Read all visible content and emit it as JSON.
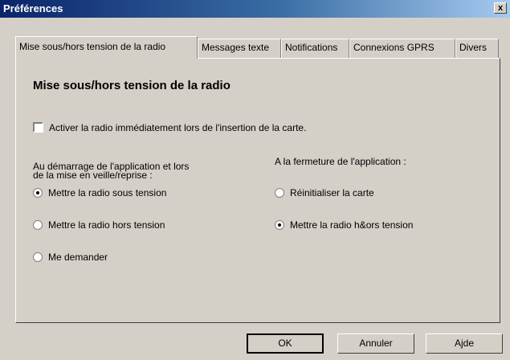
{
  "window": {
    "title": "Préférences",
    "close_glyph": "x"
  },
  "tabs": [
    {
      "label": "Mise sous/hors tension de la radio",
      "active": true
    },
    {
      "label": "Messages texte",
      "active": false
    },
    {
      "label": "Notifications",
      "active": false
    },
    {
      "label": "Connexions GPRS",
      "active": false
    },
    {
      "label": "Divers",
      "active": false
    }
  ],
  "panel": {
    "heading": "Mise sous/hors tension de la radio",
    "activate_checkbox": {
      "label": "Activer la radio immédiatement lors de l'insertion de la carte.",
      "checked": false
    },
    "startup_group": {
      "label": "Au démarrage de l'application et lors\nde la mise en veille/reprise :",
      "options": [
        {
          "label": "Mettre la radio sous tension",
          "selected": true
        },
        {
          "label": "Mettre la radio hors tension",
          "selected": false
        },
        {
          "label": "Me demander",
          "selected": false
        }
      ]
    },
    "shutdown_group": {
      "label": "A la fermeture de l'application :",
      "options": [
        {
          "label": "Réinitialiser la carte",
          "selected": false
        },
        {
          "label": "Mettre la radio h&ors tension",
          "selected": true
        }
      ]
    }
  },
  "buttons": {
    "ok": "OK",
    "cancel": "Annuler",
    "help": "Ajde"
  },
  "colors": {
    "face": "#d4d0c8",
    "title_start": "#0a246a",
    "title_end": "#a6caf0"
  }
}
